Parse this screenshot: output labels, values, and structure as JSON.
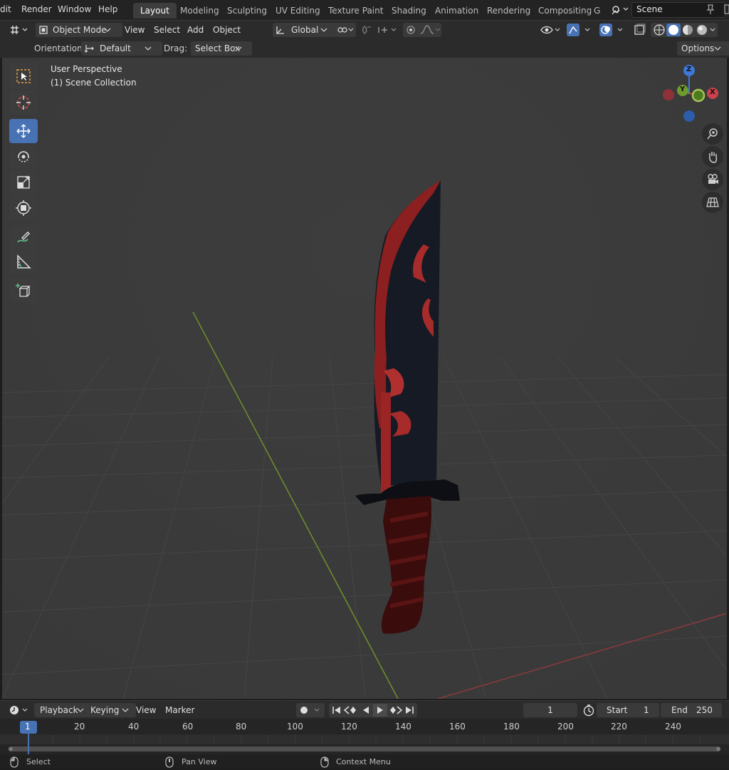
{
  "menubar": {
    "items": [
      "dit",
      "Render",
      "Window",
      "Help"
    ],
    "workspaces": [
      "Layout",
      "Modeling",
      "Sculpting",
      "UV Editing",
      "Texture Paint",
      "Shading",
      "Animation",
      "Rendering",
      "Compositing",
      "G"
    ],
    "active_workspace": "Layout",
    "scene": "Scene"
  },
  "header": {
    "mode": "Object Mode",
    "menus": [
      "View",
      "Select",
      "Add",
      "Object"
    ],
    "transform_orientation": "Global"
  },
  "tool_settings": {
    "orientation_label": "Orientation:",
    "orientation_value": "Default",
    "drag_label": "Drag:",
    "drag_value": "Select Box",
    "options": "Options"
  },
  "viewport": {
    "view_name": "User Perspective",
    "collection": "(1) Scene Collection",
    "gizmo": {
      "z": "Z",
      "y": "Y",
      "x": "X"
    },
    "colors": {
      "x_axis": "#c8414b",
      "y_axis": "#78a335",
      "z_axis": "#3c78d8"
    }
  },
  "timeline": {
    "menus": [
      "Playback",
      "Keying",
      "View",
      "Marker"
    ],
    "current_frame": "1",
    "start_label": "Start",
    "start_value": "1",
    "end_label": "End",
    "end_value": "250",
    "ticks": [
      "1",
      "20",
      "40",
      "60",
      "80",
      "100",
      "120",
      "140",
      "160",
      "180",
      "200",
      "220",
      "240"
    ]
  },
  "statusbar": {
    "select": "Select",
    "pan": "Pan View",
    "context": "Context Menu"
  }
}
